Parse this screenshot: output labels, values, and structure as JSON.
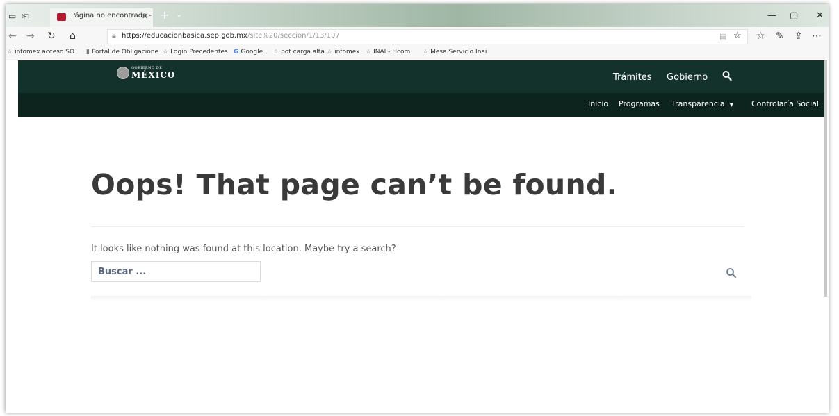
{
  "browser": {
    "tab_title": "Página no encontrada -",
    "url_domain": "https://educacionbasica.sep.gob.mx",
    "url_path": "/site%20/seccion/1/13/107",
    "favorites": [
      "infomex acceso SO",
      "Portal de Obligacione",
      "Login Precedentes",
      "Google",
      "pot carga alta",
      "infomex",
      "INAI - Hcom",
      "Mesa Servicio Inai"
    ]
  },
  "header": {
    "logo_small": "GOBIERNO DE",
    "logo_big": "MÉXICO",
    "nav": [
      "Trámites",
      "Gobierno"
    ],
    "subnav": [
      "Inicio",
      "Programas",
      "Transparencia",
      "Controlaría Social"
    ]
  },
  "main": {
    "title": "Oops! That page can’t be found.",
    "message": "It looks like nothing was found at this location. Maybe try a search?",
    "search_placeholder": "Buscar ..."
  },
  "colors": {
    "header_top": "#13322b",
    "header_sub": "#0c231e",
    "title_text": "#3a3a3a",
    "placeholder_text": "#5b6a7c"
  }
}
